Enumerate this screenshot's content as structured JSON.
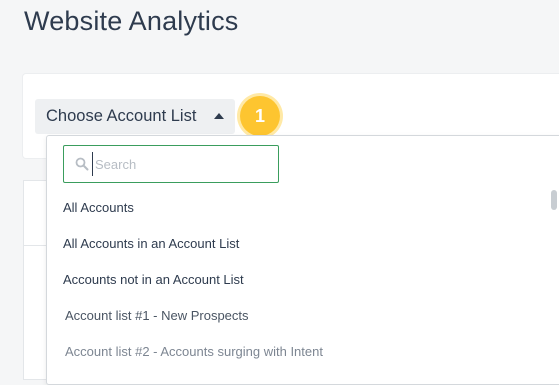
{
  "page": {
    "title": "Website Analytics"
  },
  "account_list_dropdown": {
    "button_label": "Choose Account List",
    "badge_number": "1",
    "search": {
      "placeholder": "Search",
      "value": ""
    },
    "options": [
      "All Accounts",
      "All Accounts in an Account List",
      "Accounts not in an Account List",
      "Account list #1 - New Prospects",
      "Account list #2 - Accounts surging with Intent"
    ]
  },
  "colors": {
    "badge": "#fdc530",
    "search_border": "#3a9d5d",
    "title_text": "#2e3b4e"
  },
  "icons": {
    "search": "search-icon",
    "caret": "caret-up-icon"
  }
}
